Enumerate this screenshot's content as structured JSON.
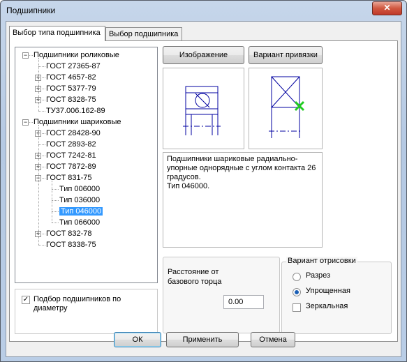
{
  "window": {
    "title": "Подшипники",
    "close_glyph": "✕"
  },
  "tabs": [
    {
      "label": "Выбор типа подшипника"
    },
    {
      "label": "Выбор подшипника"
    }
  ],
  "tree": {
    "groups": [
      {
        "label": "Подшипники роликовые",
        "toggle": "−",
        "children": [
          {
            "label": "ГОСТ 27365-87",
            "toggle": ""
          },
          {
            "label": "ГОСТ 4657-82",
            "toggle": "+"
          },
          {
            "label": "ГОСТ 5377-79",
            "toggle": "+"
          },
          {
            "label": "ГОСТ 8328-75",
            "toggle": "+"
          },
          {
            "label": "ТУ37.006.162-89",
            "toggle": ""
          }
        ]
      },
      {
        "label": "Подшипники шариковые",
        "toggle": "−",
        "children": [
          {
            "label": "ГОСТ 28428-90",
            "toggle": "+"
          },
          {
            "label": "ГОСТ 2893-82",
            "toggle": ""
          },
          {
            "label": "ГОСТ 7242-81",
            "toggle": "+"
          },
          {
            "label": "ГОСТ 7872-89",
            "toggle": "+"
          },
          {
            "label": "ГОСТ 831-75",
            "toggle": "−",
            "types": [
              "Тип 006000",
              "Тип 036000",
              "Тип 046000",
              "Тип 066000"
            ],
            "selected_index": 2
          },
          {
            "label": "ГОСТ 832-78",
            "toggle": "+"
          },
          {
            "label": "ГОСТ 8338-75",
            "toggle": ""
          }
        ]
      }
    ]
  },
  "image_button": "Изображение",
  "anchor_button": "Вариант привязки",
  "description": "Подшипники шариковые радиально-упорные однорядные с углом контакта 26 градусов.\nТип 046000.",
  "distance": {
    "label": "Расстояние от базового торца",
    "value": "0.00"
  },
  "draw_variant": {
    "title": "Вариант отрисовки",
    "options": [
      {
        "label": "Разрез",
        "checked": false
      },
      {
        "label": "Упрощенная",
        "checked": true
      }
    ],
    "mirror": {
      "label": "Зеркальная",
      "checked": false
    }
  },
  "diameter_filter": {
    "label": "Подбор подшипников по диаметру",
    "checked": true,
    "check_glyph": "✓"
  },
  "buttons": {
    "ok": "ОК",
    "apply": "Применить",
    "cancel": "Отмена"
  },
  "colors": {
    "drawing_line": "#0000a0",
    "anchor_marker": "#22cc22",
    "selection": "#3399ff"
  }
}
